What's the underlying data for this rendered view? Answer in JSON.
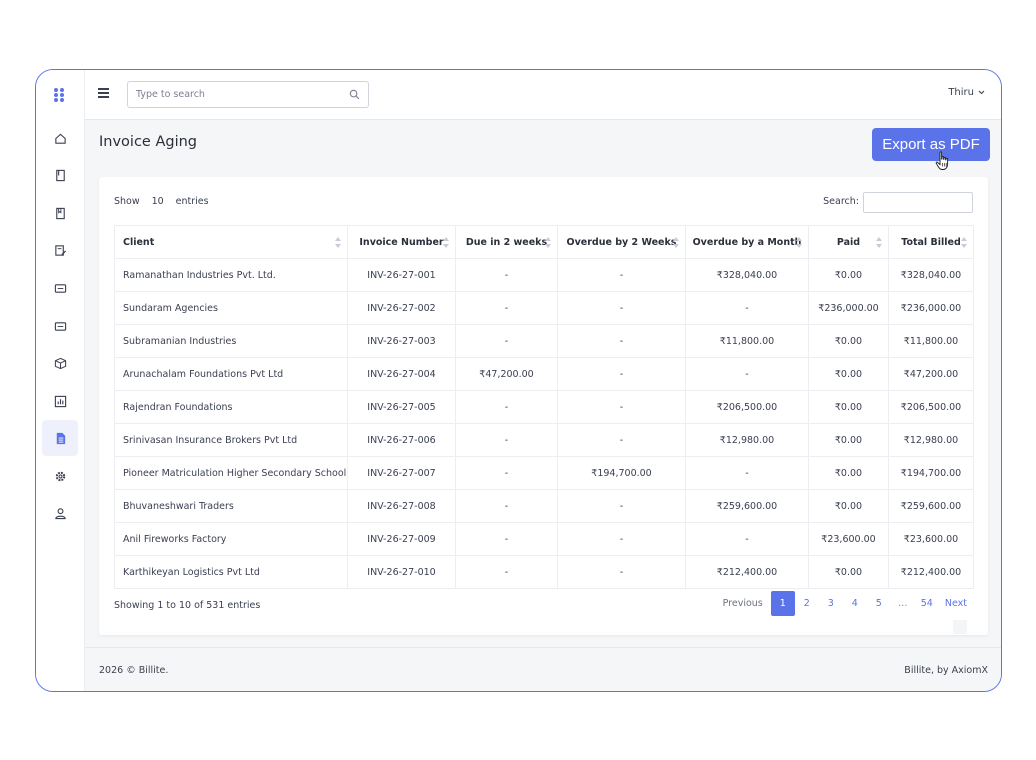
{
  "app": {
    "brand_color": "#5b73e8",
    "logo_icon": "dots-grid-logo"
  },
  "sidebar": {
    "items": [
      {
        "icon": "home-icon",
        "active": false
      },
      {
        "icon": "book-icon",
        "active": false
      },
      {
        "icon": "bookmark-icon",
        "active": false
      },
      {
        "icon": "edit-document-icon",
        "active": false
      },
      {
        "icon": "card-icon",
        "active": false
      },
      {
        "icon": "card-alt-icon",
        "active": false
      },
      {
        "icon": "box-icon",
        "active": false
      },
      {
        "icon": "chart-icon",
        "active": false
      },
      {
        "icon": "report-icon",
        "active": true
      },
      {
        "icon": "gear-icon",
        "active": false
      },
      {
        "icon": "user-icon",
        "active": false
      }
    ]
  },
  "header": {
    "search_placeholder": "Type to search",
    "user_name": "Thiru"
  },
  "page": {
    "title": "Invoice Aging",
    "export_label": "Export as PDF"
  },
  "table_controls": {
    "show_label": "Show",
    "page_length": "10",
    "entries_label": "entries",
    "search_label": "Search:"
  },
  "table": {
    "columns": [
      "Client",
      "Invoice Number",
      "Due in 2 weeks",
      "Overdue by 2 Weeks",
      "Overdue by a Month",
      "Paid",
      "Total Billed"
    ],
    "rows": [
      [
        "Ramanathan Industries Pvt. Ltd.",
        "INV-26-27-001",
        "-",
        "-",
        "₹328,040.00",
        "₹0.00",
        "₹328,040.00"
      ],
      [
        "Sundaram Agencies",
        "INV-26-27-002",
        "-",
        "-",
        "-",
        "₹236,000.00",
        "₹236,000.00"
      ],
      [
        "Subramanian Industries",
        "INV-26-27-003",
        "-",
        "-",
        "₹11,800.00",
        "₹0.00",
        "₹11,800.00"
      ],
      [
        "Arunachalam Foundations Pvt Ltd",
        "INV-26-27-004",
        "₹47,200.00",
        "-",
        "-",
        "₹0.00",
        "₹47,200.00"
      ],
      [
        "Rajendran Foundations",
        "INV-26-27-005",
        "-",
        "-",
        "₹206,500.00",
        "₹0.00",
        "₹206,500.00"
      ],
      [
        "Srinivasan Insurance Brokers Pvt Ltd",
        "INV-26-27-006",
        "-",
        "-",
        "₹12,980.00",
        "₹0.00",
        "₹12,980.00"
      ],
      [
        "Pioneer Matriculation Higher Secondary School",
        "INV-26-27-007",
        "-",
        "₹194,700.00",
        "-",
        "₹0.00",
        "₹194,700.00"
      ],
      [
        "Bhuvaneshwari Traders",
        "INV-26-27-008",
        "-",
        "-",
        "₹259,600.00",
        "₹0.00",
        "₹259,600.00"
      ],
      [
        "Anil Fireworks Factory",
        "INV-26-27-009",
        "-",
        "-",
        "-",
        "₹23,600.00",
        "₹23,600.00"
      ],
      [
        "Karthikeyan Logistics Pvt Ltd",
        "INV-26-27-010",
        "-",
        "-",
        "₹212,400.00",
        "₹0.00",
        "₹212,400.00"
      ]
    ]
  },
  "pagination": {
    "info": "Showing 1 to 10 of 531 entries",
    "previous": "Previous",
    "pages": [
      "1",
      "2",
      "3",
      "4",
      "5",
      "…",
      "54"
    ],
    "active_page": "1",
    "next": "Next"
  },
  "footer": {
    "copyright": "2026 © Billite.",
    "credit": "Billite, by AxiomX"
  }
}
